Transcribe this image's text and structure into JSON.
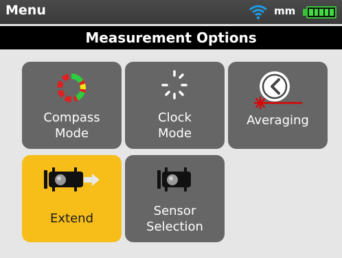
{
  "status_bar": {
    "title": "Menu",
    "wifi_icon": "wifi-icon",
    "unit": "mm",
    "battery_icon": "battery-full-icon",
    "battery_level": 1.0
  },
  "header": {
    "title": "Measurement Options"
  },
  "tiles": [
    {
      "label": "Compass\nMode",
      "icon": "compass-mode-icon",
      "selected": false
    },
    {
      "label": "Clock\nMode",
      "icon": "clock-mode-icon",
      "selected": false
    },
    {
      "label": "Averaging",
      "icon": "averaging-icon",
      "selected": false
    },
    {
      "label": "Extend",
      "icon": "extend-icon",
      "selected": true
    },
    {
      "label": "Sensor\nSelection",
      "icon": "sensor-selection-icon",
      "selected": false
    }
  ],
  "colors": {
    "tile_bg": "#666666",
    "tile_selected_bg": "#f7be1a",
    "page_bg": "#e6e6e6",
    "header_bg": "#000000",
    "wifi_blue": "#1e9be6",
    "battery_green": "#3fdc3f",
    "compass_red": "#e02020",
    "compass_green": "#2ecc40",
    "compass_yellow": "#f5e614",
    "averaging_red": "#e00000"
  }
}
